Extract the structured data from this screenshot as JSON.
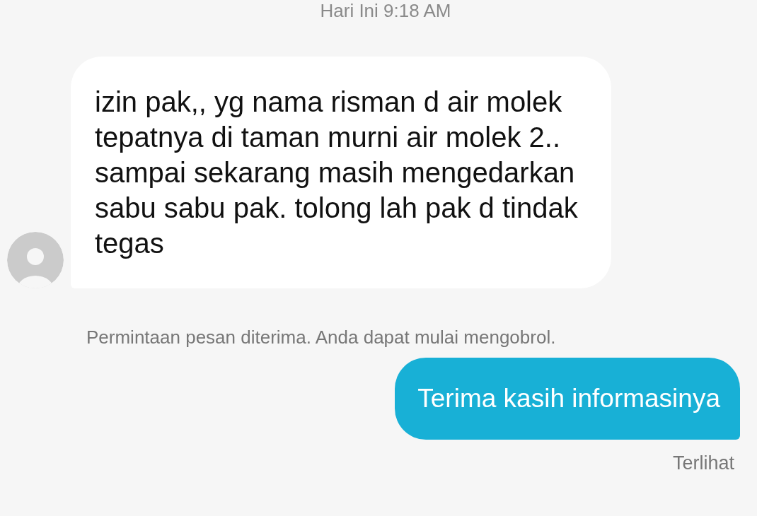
{
  "timestamp": "Hari Ini 9:18 AM",
  "messages": [
    {
      "kind": "incoming",
      "text": "izin pak,, yg nama risman d air molek tepatnya di taman murni air molek 2.. sampai sekarang masih mengedarkan sabu sabu pak. tolong lah pak d tindak tegas"
    },
    {
      "kind": "notice",
      "text": "Permintaan pesan diterima. Anda dapat mulai mengobrol."
    },
    {
      "kind": "outgoing",
      "text": "Terima kasih informasinya",
      "status": "Terlihat"
    }
  ]
}
